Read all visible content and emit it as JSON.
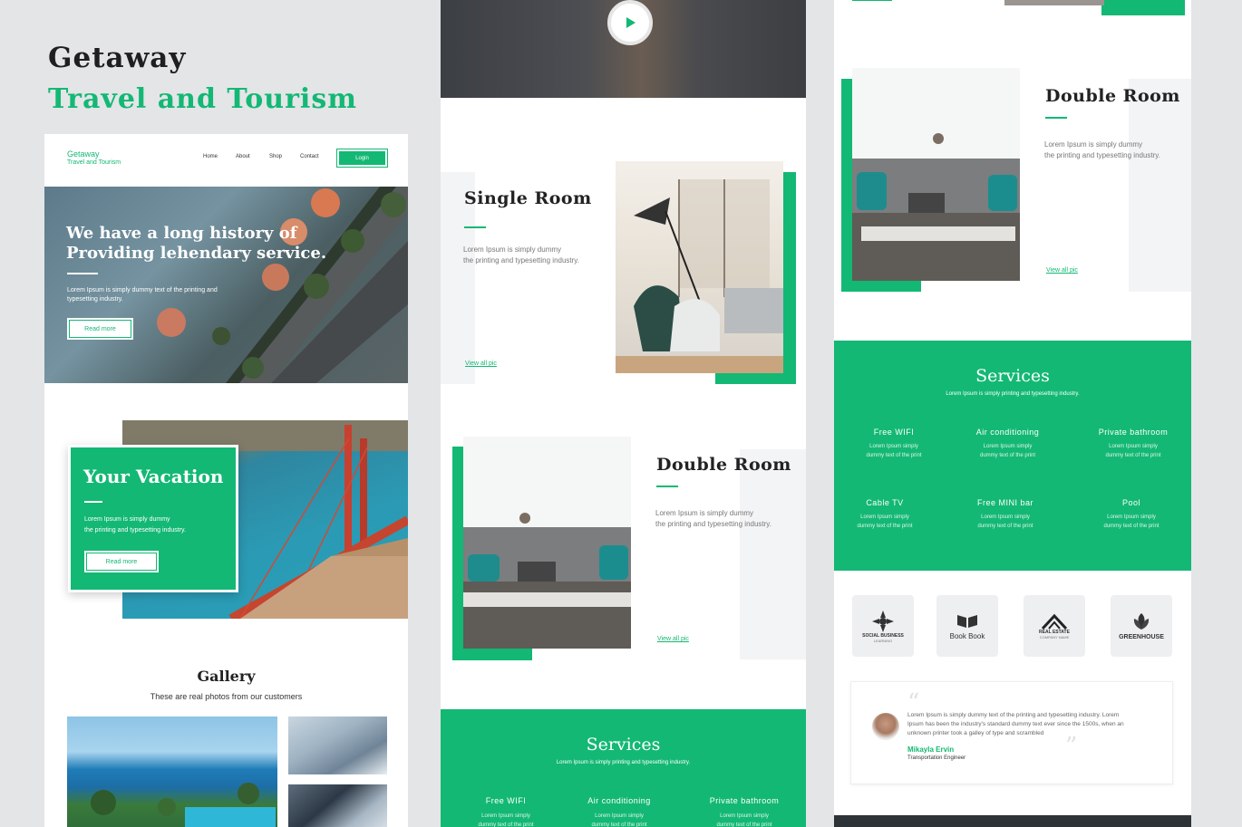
{
  "brand": {
    "name": "Getaway",
    "tagline": "Travel and Tourism"
  },
  "nav": {
    "items": [
      "Home",
      "About",
      "Shop",
      "Contact"
    ],
    "login": "Login"
  },
  "hero": {
    "title_line1": "We have a long history of",
    "title_line2": "Providing lehendary service.",
    "text_line1": "Lorem Ipsum is simply dummy text of the printing and",
    "text_line2": "typesetting industry.",
    "button": "Read more"
  },
  "vacation": {
    "title": "Your Vacation",
    "text_line1": "Lorem Ipsum is simply dummy",
    "text_line2": "the printing and typesetting industry.",
    "button": "Read more"
  },
  "gallery": {
    "title": "Gallery",
    "subtitle": "These are real photos from our customers"
  },
  "single_room": {
    "title": "Single Room",
    "text_line1": "Lorem Ipsum is simply dummy",
    "text_line2": "the printing and typesetting industry.",
    "link": "View all pic"
  },
  "double_room": {
    "title": "Double Room",
    "text_line1": "Lorem Ipsum is simply dummy",
    "text_line2": "the printing and typesetting industry.",
    "link": "View all pic"
  },
  "services": {
    "title": "Services",
    "subtitle": "Lorem Ipsum is simply printing and typesetting industry.",
    "items": [
      {
        "name": "Free WIFI",
        "desc1": "Lorem Ipsum simply",
        "desc2": "dummy text of the print"
      },
      {
        "name": "Air conditioning",
        "desc1": "Lorem Ipsum simply",
        "desc2": "dummy text of the print"
      },
      {
        "name": "Private bathroom",
        "desc1": "Lorem Ipsum simply",
        "desc2": "dummy text of the print"
      },
      {
        "name": "Cable TV",
        "desc1": "Lorem Ipsum simply",
        "desc2": "dummy text of the print"
      },
      {
        "name": "Free MINI bar",
        "desc1": "Lorem Ipsum simply",
        "desc2": "dummy text of the print"
      },
      {
        "name": "Pool",
        "desc1": "Lorem Ipsum simply",
        "desc2": "dummy text of the print"
      }
    ]
  },
  "logos": [
    {
      "name": "SOCIAL BUSINESS",
      "sub": "LEARNING"
    },
    {
      "name": "Book Book",
      "sub": ""
    },
    {
      "name": "REAL ESTATE",
      "sub": "COMPANY NAME"
    },
    {
      "name": "GREENHOUSE",
      "sub": ""
    }
  ],
  "testimonial": {
    "text_line1": "Lorem Ipsum is simply dummy text of the printing and typesetting industry. Lorem",
    "text_line2": "Ipsum has been the industry's standard dummy text ever since the 1500s, when an",
    "text_line3": "unknown printer took a galley of type and scrambled",
    "name": "Mikayla Ervin",
    "role": "Transportation Engineer"
  },
  "colors": {
    "accent": "#13b874",
    "background": "#e4e5e7"
  }
}
